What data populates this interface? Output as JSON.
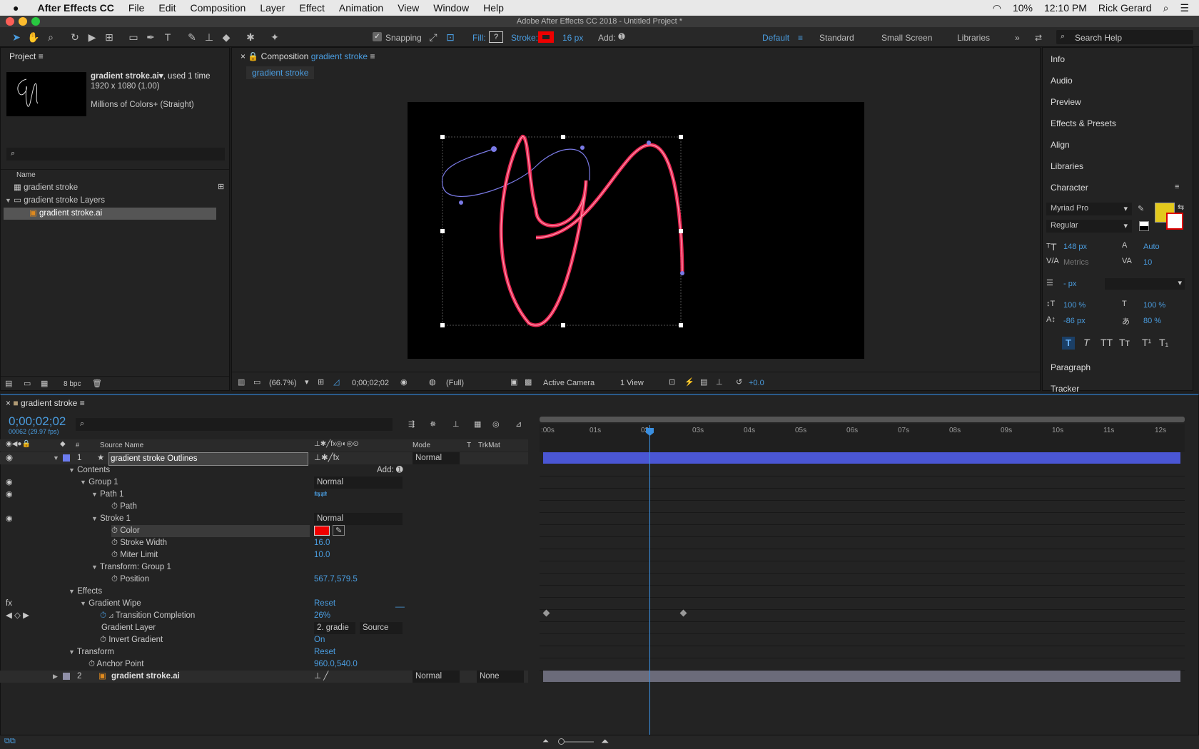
{
  "menubar": {
    "app": "After Effects CC",
    "items": [
      "File",
      "Edit",
      "Composition",
      "Layer",
      "Effect",
      "Animation",
      "View",
      "Window",
      "Help"
    ],
    "battery": "10%",
    "time": "12:10 PM",
    "user": "Rick Gerard"
  },
  "title": "Adobe After Effects CC 2018 - Untitled Project *",
  "toolbar": {
    "snapping": "Snapping",
    "fill": "Fill:",
    "stroke": "Stroke:",
    "stroke_px": "16 px",
    "add": "Add:",
    "workspaces": [
      "Default",
      "Standard",
      "Small Screen",
      "Libraries"
    ],
    "search": "Search Help"
  },
  "project": {
    "title": "Project",
    "item_name": "gradient stroke.ai",
    "used": ", used 1 time",
    "dims": "1920 x 1080 (1.00)",
    "colors": "Millions of Colors+ (Straight)",
    "col_name": "Name",
    "items": [
      "gradient stroke",
      "gradient stroke Layers",
      "gradient stroke.ai"
    ],
    "bpc": "8 bpc"
  },
  "comp": {
    "header_prefix": "Composition",
    "name": "gradient stroke",
    "tab": "gradient stroke",
    "zoom": "(66.7%)",
    "time": "0;00;02;02",
    "quality": "(Full)",
    "camera": "Active Camera",
    "view": "1 View",
    "exposure": "+0.0"
  },
  "right": {
    "items": [
      "Info",
      "Audio",
      "Preview",
      "Effects & Presets",
      "Align",
      "Libraries",
      "Character"
    ],
    "font": "Myriad Pro",
    "style": "Regular",
    "size": "148 px",
    "leading": "Auto",
    "kerning": "Metrics",
    "tracking": "10",
    "stroke_w": "- px",
    "vscale": "100 %",
    "hscale": "100 %",
    "baseline": "-86 px",
    "tsume": "80 %",
    "paragraph": "Paragraph",
    "tracker": "Tracker",
    "fill_color": "#e3c91c"
  },
  "timeline": {
    "title": "gradient stroke",
    "timecode": "0;00;02;02",
    "frames": "00062 (29.97 fps)",
    "col_source": "Source Name",
    "col_mode": "Mode",
    "col_t": "T",
    "col_trk": "TrkMat",
    "ruler": [
      ":00s",
      "01s",
      "02s",
      "03s",
      "04s",
      "05s",
      "06s",
      "07s",
      "08s",
      "09s",
      "10s",
      "11s",
      "12s"
    ],
    "rows": [
      {
        "n": "1",
        "label": "gradient stroke Outlines",
        "mode": "Normal"
      },
      {
        "label": "Contents",
        "add": "Add:"
      },
      {
        "label": "Group 1",
        "mode": "Normal"
      },
      {
        "label": "Path 1"
      },
      {
        "label": "Path"
      },
      {
        "label": "Stroke 1",
        "mode": "Normal"
      },
      {
        "label": "Color"
      },
      {
        "label": "Stroke Width",
        "val": "16.0"
      },
      {
        "label": "Miter Limit",
        "val": "10.0"
      },
      {
        "label": "Transform: Group 1"
      },
      {
        "label": "Position",
        "val": "567.7,579.5"
      },
      {
        "label": "Effects"
      },
      {
        "label": "Gradient Wipe",
        "val": "Reset"
      },
      {
        "label": "Transition Completion",
        "val": "26%"
      },
      {
        "label": "Gradient Layer",
        "val": "2. gradie",
        "src": "Source"
      },
      {
        "label": "Invert Gradient",
        "val": "On"
      },
      {
        "label": "Transform",
        "val": "Reset"
      },
      {
        "label": "Anchor Point",
        "val": "960.0,540.0"
      },
      {
        "n": "2",
        "label": "gradient stroke.ai",
        "mode": "Normal",
        "trk": "None"
      }
    ]
  }
}
